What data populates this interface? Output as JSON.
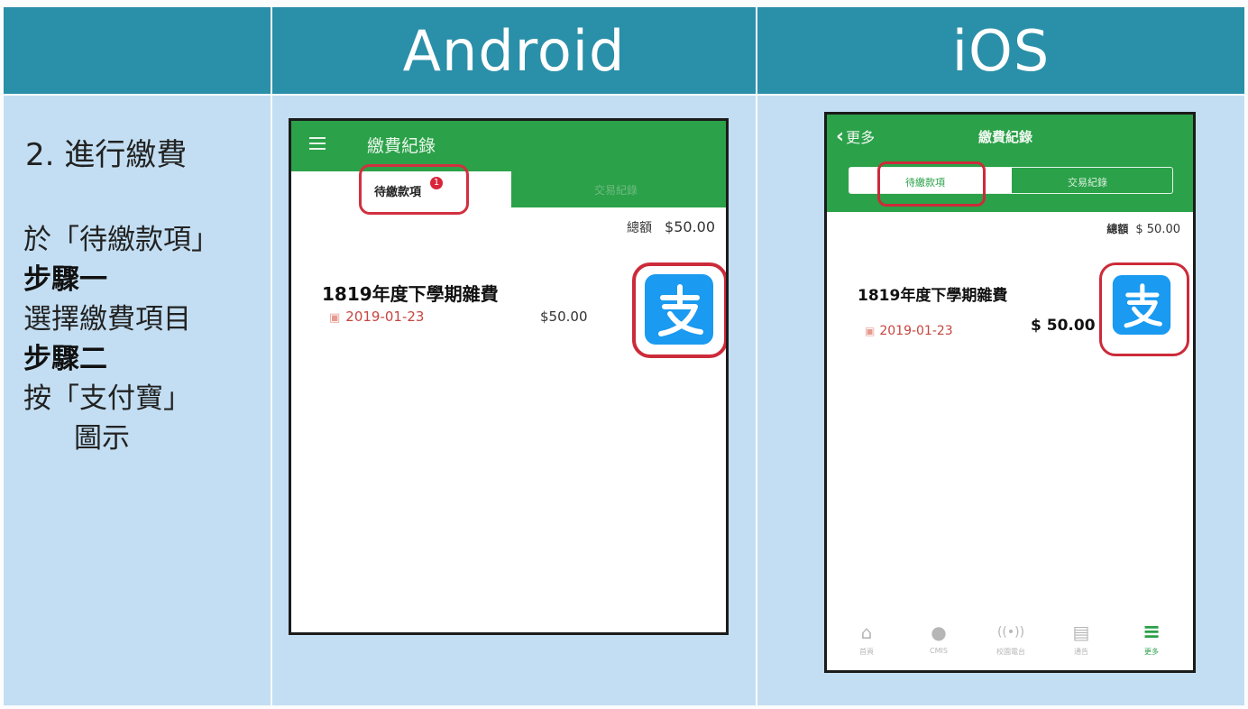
{
  "header": {
    "android": "Android",
    "ios": "iOS"
  },
  "step": {
    "title": "2. 進行繳費",
    "lines": [
      {
        "text": "於「待繳款項」",
        "bold": false
      },
      {
        "text": "步驟一",
        "bold": true
      },
      {
        "text": "選擇繳費項目",
        "bold": false
      },
      {
        "text": "步驟二",
        "bold": true
      },
      {
        "text": "按「支付寶」",
        "bold": false
      },
      {
        "text": "圖示",
        "bold": false
      }
    ]
  },
  "android": {
    "title": "繳費紀錄",
    "tab_pending": "待繳款項",
    "tab_pending_badge": "1",
    "tab_history": "交易紀錄",
    "total_label": "總額",
    "total_value": "$50.00",
    "item": {
      "name": "1819年度下學期雜費",
      "date": "2019-01-23",
      "amount": "$50.00"
    },
    "pay_icon": "alipay-icon"
  },
  "ios": {
    "back_label": "更多",
    "title": "繳費紀錄",
    "tab_pending": "待繳款項",
    "tab_history": "交易紀錄",
    "total_label": "總額",
    "total_value": "$ 50.00",
    "item": {
      "name": "1819年度下學期雜費",
      "date": "2019-01-23",
      "amount": "$ 50.00"
    },
    "pay_icon": "alipay-icon",
    "tabbar": [
      {
        "label": "首頁",
        "icon": "home-icon"
      },
      {
        "label": "CMIS",
        "icon": "message-icon"
      },
      {
        "label": "校園電台",
        "icon": "broadcast-icon"
      },
      {
        "label": "通告",
        "icon": "notice-icon"
      },
      {
        "label": "更多",
        "icon": "more-icon",
        "active": true
      }
    ]
  },
  "colors": {
    "header": "#2a8fa8",
    "panel": "#c3def2",
    "app_green": "#2ba149",
    "highlight_red": "#cc2b3a",
    "alipay_blue": "#1a9af0"
  }
}
